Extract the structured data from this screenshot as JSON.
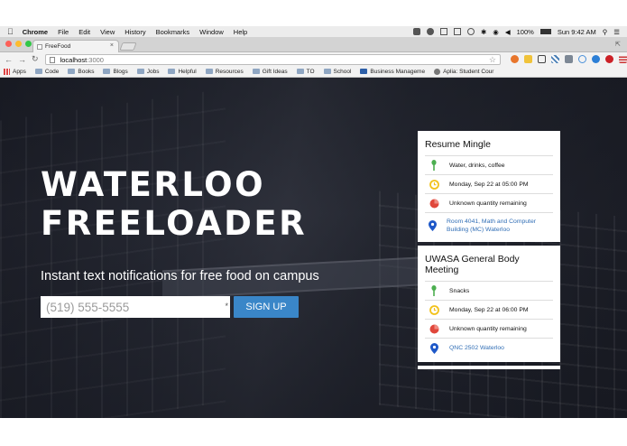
{
  "menubar": {
    "app": "Chrome",
    "items": [
      "File",
      "Edit",
      "View",
      "History",
      "Bookmarks",
      "Window",
      "Help"
    ],
    "battery": "100%",
    "clock": "Sun 9:42 AM"
  },
  "tab": {
    "title": "FreeFood"
  },
  "address": {
    "host": "localhost",
    "port": ":3000"
  },
  "bookmarks": [
    "Apps",
    "Code",
    "Books",
    "Blogs",
    "Jobs",
    "Helpful",
    "Resources",
    "Gift Ideas",
    "TO",
    "School",
    "Business Manageme",
    "Aplia: Student Cour"
  ],
  "hero": {
    "title_line1": "WATERLOO",
    "title_line2": "FREELOADER",
    "tagline": "Instant text notifications for free food on campus",
    "phone_placeholder": "(519) 555-5555",
    "required_mark": "*",
    "signup_label": "SIGN UP"
  },
  "events": [
    {
      "title": "Resume Mingle",
      "food": "Water, drinks, coffee",
      "time": "Monday, Sep 22 at 05:00 PM",
      "quantity": "Unknown quantity remaining",
      "location": "Room 4041, Math and Computer Building (MC) Waterloo"
    },
    {
      "title": "UWASA General Body Meeting",
      "food": "Snacks",
      "time": "Monday, Sep 22 at 06:00 PM",
      "quantity": "Unknown quantity remaining",
      "location": "QNC 2502 Waterloo"
    }
  ],
  "colors": {
    "accent": "#3a86c8",
    "link": "#2f6db5",
    "food_icon": "#4caf50",
    "time_icon": "#f2c21b",
    "qty_icon": "#e0473b",
    "loc_icon": "#1e58c8"
  }
}
